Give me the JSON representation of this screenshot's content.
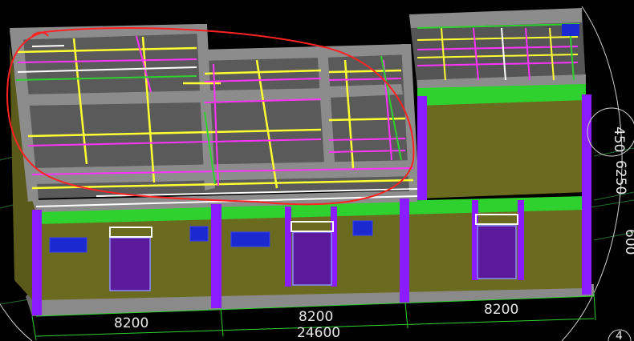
{
  "viewport": {
    "background": "#000000",
    "model": {
      "colors": {
        "slab_top": "#5a5a5a",
        "beam_grey": "#8c8c8c",
        "wall_olive": "#6b6b1f",
        "column_purple": "#8a1cff",
        "band_green": "#2fd12f",
        "door_purple": "#5a1a9a",
        "window_blue": "#1a2ad0",
        "rebar_yellow": "#ffff33",
        "rebar_magenta": "#ff33ff",
        "rebar_white": "#ffffff",
        "markup_red": "#ff2222"
      }
    },
    "dimensions": {
      "bay_1": "8200",
      "bay_2": "8200",
      "bay_3": "8200",
      "total": "24600",
      "right_450": "450",
      "right_6250": "6250",
      "right_partial": "600",
      "corner_label": "4"
    }
  }
}
